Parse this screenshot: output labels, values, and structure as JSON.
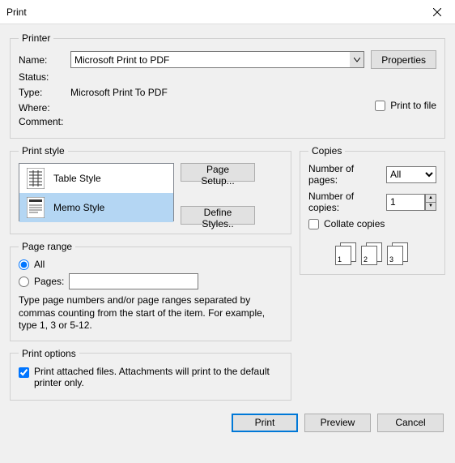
{
  "window": {
    "title": "Print"
  },
  "printer": {
    "legend": "Printer",
    "name_label": "Name:",
    "name_value": "Microsoft Print to PDF",
    "status_label": "Status:",
    "status_value": "",
    "type_label": "Type:",
    "type_value": "Microsoft Print To PDF",
    "where_label": "Where:",
    "where_value": "",
    "comment_label": "Comment:",
    "comment_value": "",
    "properties_btn": "Properties",
    "print_to_file_label": "Print to file",
    "print_to_file_checked": false
  },
  "print_style": {
    "legend": "Print style",
    "items": [
      {
        "label": "Table Style",
        "selected": false
      },
      {
        "label": "Memo Style",
        "selected": true
      }
    ],
    "page_setup_btn": "Page Setup...",
    "define_styles_btn": "Define Styles.."
  },
  "copies": {
    "legend": "Copies",
    "num_pages_label": "Number of pages:",
    "num_pages_value": "All",
    "num_copies_label": "Number of copies:",
    "num_copies_value": "1",
    "collate_label": "Collate copies",
    "collate_checked": false,
    "collate_pages": [
      "1",
      "1",
      "2",
      "2",
      "3",
      "3"
    ]
  },
  "page_range": {
    "legend": "Page range",
    "all_label": "All",
    "all_selected": true,
    "pages_label": "Pages:",
    "pages_selected": false,
    "pages_value": "",
    "help": "Type page numbers and/or page ranges separated by commas counting from the start of the item.  For example, type 1, 3 or 5-12."
  },
  "print_options": {
    "legend": "Print options",
    "attach_label": "Print attached files.  Attachments will print to the default printer only.",
    "attach_checked": true
  },
  "footer": {
    "print": "Print",
    "preview": "Preview",
    "cancel": "Cancel"
  }
}
